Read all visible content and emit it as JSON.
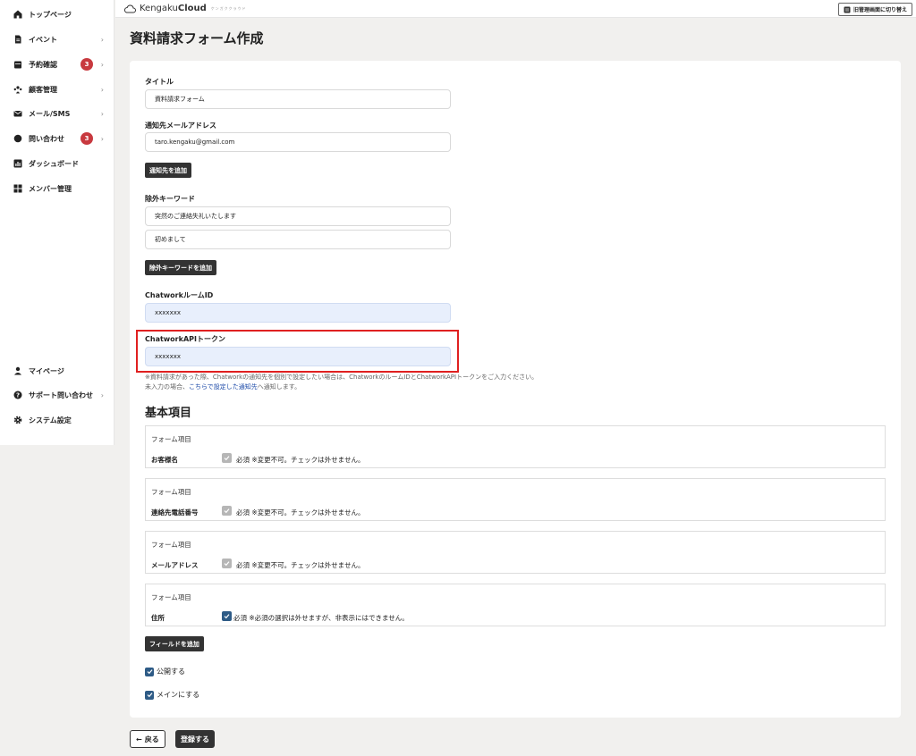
{
  "sidebar": {
    "items": [
      {
        "label": "トップページ",
        "icon": "home-icon"
      },
      {
        "label": "イベント",
        "icon": "document-icon"
      },
      {
        "label": "予約確認",
        "icon": "calendar-icon",
        "badge": "3"
      },
      {
        "label": "顧客管理",
        "icon": "users-icon"
      },
      {
        "label": "メール/SMS",
        "icon": "mail-icon"
      },
      {
        "label": "問い合わせ",
        "icon": "chat-icon",
        "badge": "3"
      },
      {
        "label": "ダッシュボード",
        "icon": "chart-icon"
      },
      {
        "label": "メンバー管理",
        "icon": "grid-icon"
      }
    ],
    "bottom_items": [
      {
        "label": "マイページ",
        "icon": "person-icon"
      },
      {
        "label": "サポート問い合わせ",
        "icon": "help-icon"
      },
      {
        "label": "システム設定",
        "icon": "gear-icon"
      }
    ]
  },
  "header": {
    "logo_prefix": "Kengaku",
    "logo_bold": "Cloud",
    "logo_sub": "ケンガククラウド",
    "switch_label": "旧管理画面に切り替え"
  },
  "page": {
    "title": "資料請求フォーム作成"
  },
  "form": {
    "title_label": "タイトル",
    "title_value": "資料請求フォーム",
    "email_label": "通知先メールアドレス",
    "email_value": "taro.kengaku@gmail.com",
    "add_notify_label": "通知先を追加",
    "exclude_label": "除外キーワード",
    "exclude_values": [
      "突然のご連絡失礼いたします",
      "初めまして"
    ],
    "add_exclude_label": "除外キーワードを追加",
    "room_label": "ChatworkルームID",
    "room_value": "xxxxxxx",
    "token_label": "ChatworkAPIトークン",
    "token_value": "xxxxxxx",
    "note1": "※資料請求があった際、Chatworkの通知先を個別で設定したい場合は、ChatworkのルームIDとChatworkAPIトークンをご入力ください。",
    "note2_prefix": "未入力の場合、",
    "note2_link": "こちらで設定した通知先",
    "note2_suffix": "へ通知します。"
  },
  "basic": {
    "title": "基本項目",
    "items": [
      {
        "caption": "フォーム項目",
        "name": "お客様名",
        "text": "必須 ※変更不可。チェックは外せません。",
        "checked_editable": false
      },
      {
        "caption": "フォーム項目",
        "name": "連絡先電話番号",
        "text": "必須 ※変更不可。チェックは外せません。",
        "checked_editable": false
      },
      {
        "caption": "フォーム項目",
        "name": "メールアドレス",
        "text": "必須 ※変更不可。チェックは外せません。",
        "checked_editable": false
      },
      {
        "caption": "フォーム項目",
        "name": "住所",
        "text": "必須 ※必須の選択は外せますが、非表示にはできません。",
        "checked_editable": true
      }
    ],
    "add_field_label": "フィールドを追加",
    "publish_label": "公開する",
    "main_label": "メインにする"
  },
  "footer": {
    "back_label": "戻る",
    "save_label": "登録する"
  },
  "colors": {
    "accent": "#2e5b86",
    "badge": "#c8393f",
    "highlight": "#e02020",
    "dark_button": "#333333"
  }
}
